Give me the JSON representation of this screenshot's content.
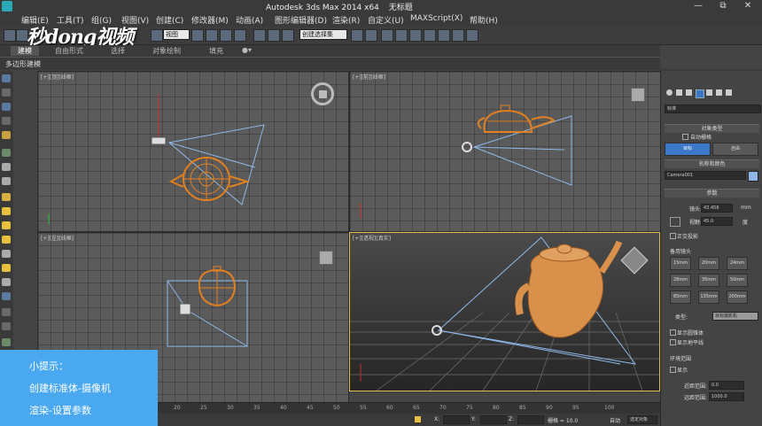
{
  "titlebar": {
    "app_title": "Autodesk 3ds Max  2014 x64",
    "doc_title": "无标题",
    "min_glyph": "—",
    "max_glyph": "⧉",
    "close_glyph": "✕"
  },
  "menu": [
    "编辑(E)",
    "工具(T)",
    "组(G)",
    "视图(V)",
    "创建(C)",
    "修改器(M)",
    "动画(A)",
    "图形编辑器(D)",
    "渲染(R)",
    "自定义(U)",
    "MAXScript(X)",
    "帮助(H)"
  ],
  "toolbar": {
    "view_dropdown": "视图",
    "selection_set": "创建选择集"
  },
  "watermark": {
    "text": "秒dong视频"
  },
  "ribbon": {
    "tabs": [
      "建模",
      "自由形式",
      "选择",
      "对象绘制",
      "填充"
    ],
    "panel_label": "多边形建模"
  },
  "viewports": {
    "top": "[+][顶][线框]",
    "front": "[+][前][线框]",
    "left": "[+][左][线框]",
    "perspective": "[+][透视][真实]"
  },
  "command_panel": {
    "category_dropdown": "标准",
    "object_type_header": "对象类型",
    "autogrid_label": "自动栅格",
    "btn_target": "目标",
    "btn_free": "自由",
    "name_color_header": "名称和颜色",
    "object_name": "Camera001",
    "params_header": "参数",
    "lens_label": "镜头:",
    "lens_value": "43.456",
    "lens_unit": "mm",
    "fov_label": "视野:",
    "fov_value": "45.0",
    "fov_unit": "度",
    "ortho_label": "正交投影",
    "stock_lens_header": "备用镜头",
    "stock_lenses": [
      "15mm",
      "20mm",
      "24mm",
      "28mm",
      "35mm",
      "50mm",
      "85mm",
      "135mm",
      "200mm"
    ],
    "type_label": "类型:",
    "type_value": "目标摄影机",
    "show_cone": "显示圆锥体",
    "show_horizon": "显示地平线",
    "env_range_header": "环境范围",
    "env_show": "显示",
    "near_range_label": "近距范围:",
    "near_range_value": "0.0",
    "far_range_label": "远距范围:",
    "far_range_value": "1000.0"
  },
  "tip": {
    "title": "小提示：",
    "line1": "创建标准体-摄像机",
    "line2": "渲染-设置参数"
  },
  "timeline": {
    "ticks": [
      "20",
      "25",
      "30",
      "35",
      "40",
      "45",
      "50",
      "55",
      "60",
      "65",
      "70",
      "75",
      "80",
      "85",
      "90",
      "95",
      "100"
    ]
  },
  "statusbar": {
    "x_label": "X:",
    "y_label": "Y:",
    "z_label": "Z:",
    "grid_label": "栅格 = 10.0",
    "auto_label": "自动",
    "selected_dropdown": "选定对象"
  },
  "colors": {
    "teapot": "#e08020",
    "camera_lines": "#8fb8e8",
    "tip_bg": "#4aa8f0",
    "active_button": "#3c78c8"
  }
}
